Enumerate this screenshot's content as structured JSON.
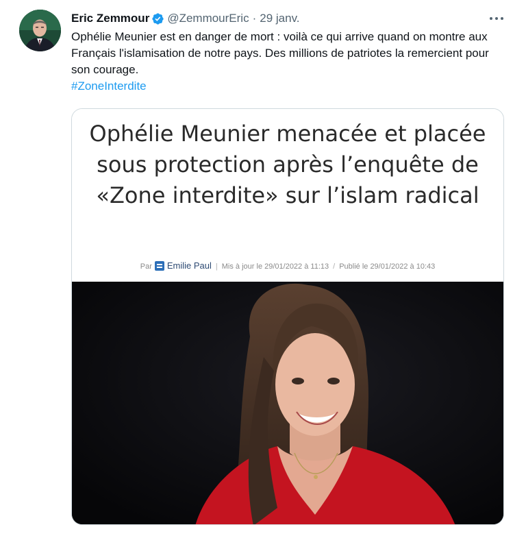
{
  "tweet": {
    "author_name": "Eric Zemmour",
    "handle": "@ZemmourEric",
    "separator": "·",
    "date": "29 janv.",
    "body_line1": "Ophélie Meunier est en danger de mort : voilà ce qui arrive quand on montre aux Français l'islamisation de notre pays. Des millions de patriotes la remercient pour son courage.",
    "hashtag": "#ZoneInterdite"
  },
  "card": {
    "headline": "Ophélie Meunier menacée et placée sous protection après l’enquête de «Zone interdite» sur l’islam radical",
    "byline_prefix": "Par",
    "byline_author": "Emilie Paul",
    "byline_sep1": "|",
    "byline_updated": "Mis à jour le 29/01/2022 à 11:13",
    "byline_sep2": "/",
    "byline_published": "Publié le 29/01/2022 à 10:43"
  },
  "colors": {
    "link": "#1d9bf0",
    "verified": "#1d9bf0",
    "secondary_text": "#536471"
  },
  "icons": {
    "verified": "verified-badge-icon",
    "more": "more-options-icon"
  }
}
